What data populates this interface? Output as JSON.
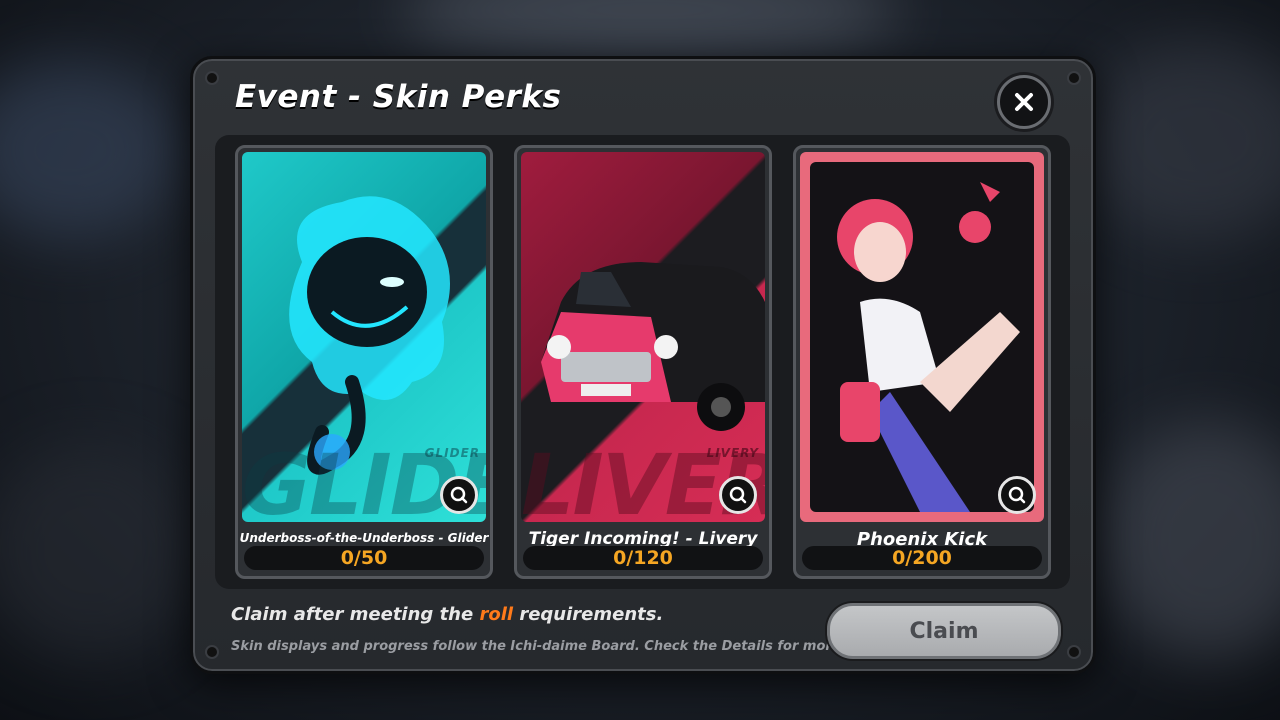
{
  "dialog": {
    "title": "Event - Skin Perks",
    "claim_note_prefix": "Claim after meeting the ",
    "claim_note_highlight": "roll",
    "claim_note_suffix": " requirements.",
    "sub_note": "Skin displays and progress follow the Ichi-daime Board. Check the Details for more info.",
    "claim_label": "Claim"
  },
  "cards": [
    {
      "name": "Underboss-of-the-Underboss - Glider",
      "progress": "0/50",
      "tag": "GLIDER",
      "big_word": "GLIDE"
    },
    {
      "name": "Tiger Incoming! - Livery",
      "progress": "0/120",
      "tag": "LIVERY",
      "big_word": "LIVERY"
    },
    {
      "name": "Phoenix Kick",
      "progress": "0/200",
      "tag": "",
      "big_word": ""
    }
  ],
  "colors": {
    "progress": "#f5a623",
    "highlight": "#ff7a1a",
    "glider_bg": "#1fc9c9",
    "livery_bg": "#c8284f",
    "phoenix_bg": "#e86a7c"
  },
  "icons": {
    "close": "close-icon",
    "zoom": "zoom-icon"
  }
}
